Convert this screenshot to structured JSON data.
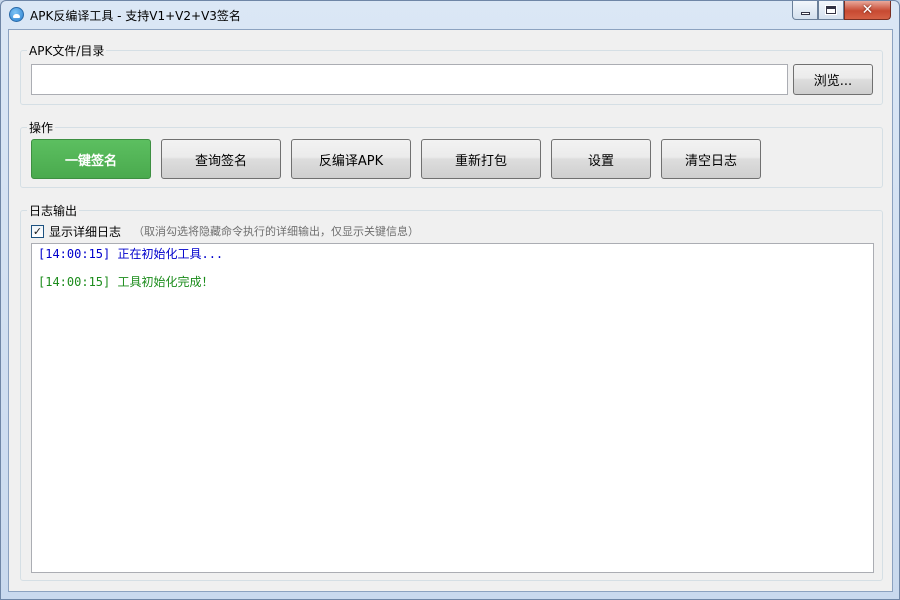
{
  "window": {
    "title": "APK反编译工具 - 支持V1+V2+V3签名",
    "controls": {
      "minimize": "min",
      "maximize": "max",
      "close": "✕"
    }
  },
  "apk_group": {
    "label": "APK文件/目录",
    "input_value": "",
    "browse_label": "浏览..."
  },
  "ops_group": {
    "label": "操作",
    "buttons": [
      {
        "label": "一键签名",
        "style": "primary",
        "color": "#4aaa4e"
      },
      {
        "label": "查询签名"
      },
      {
        "label": "反编译APK"
      },
      {
        "label": "重新打包"
      },
      {
        "label": "设置"
      },
      {
        "label": "清空日志"
      }
    ]
  },
  "log_group": {
    "label": "日志输出",
    "verbose_checked": true,
    "verbose_label": "显示详细日志",
    "verbose_hint": "（取消勾选将隐藏命令执行的详细输出，仅显示关键信息）",
    "lines": [
      {
        "text": "[14:00:15] 正在初始化工具...",
        "color": "#0000cc"
      },
      {
        "text": "[14:00:15] 工具初始化完成！",
        "color": "#1c8c1c"
      }
    ]
  },
  "icons": {
    "app": "android-app-icon",
    "checkbox_mark": "✓"
  }
}
